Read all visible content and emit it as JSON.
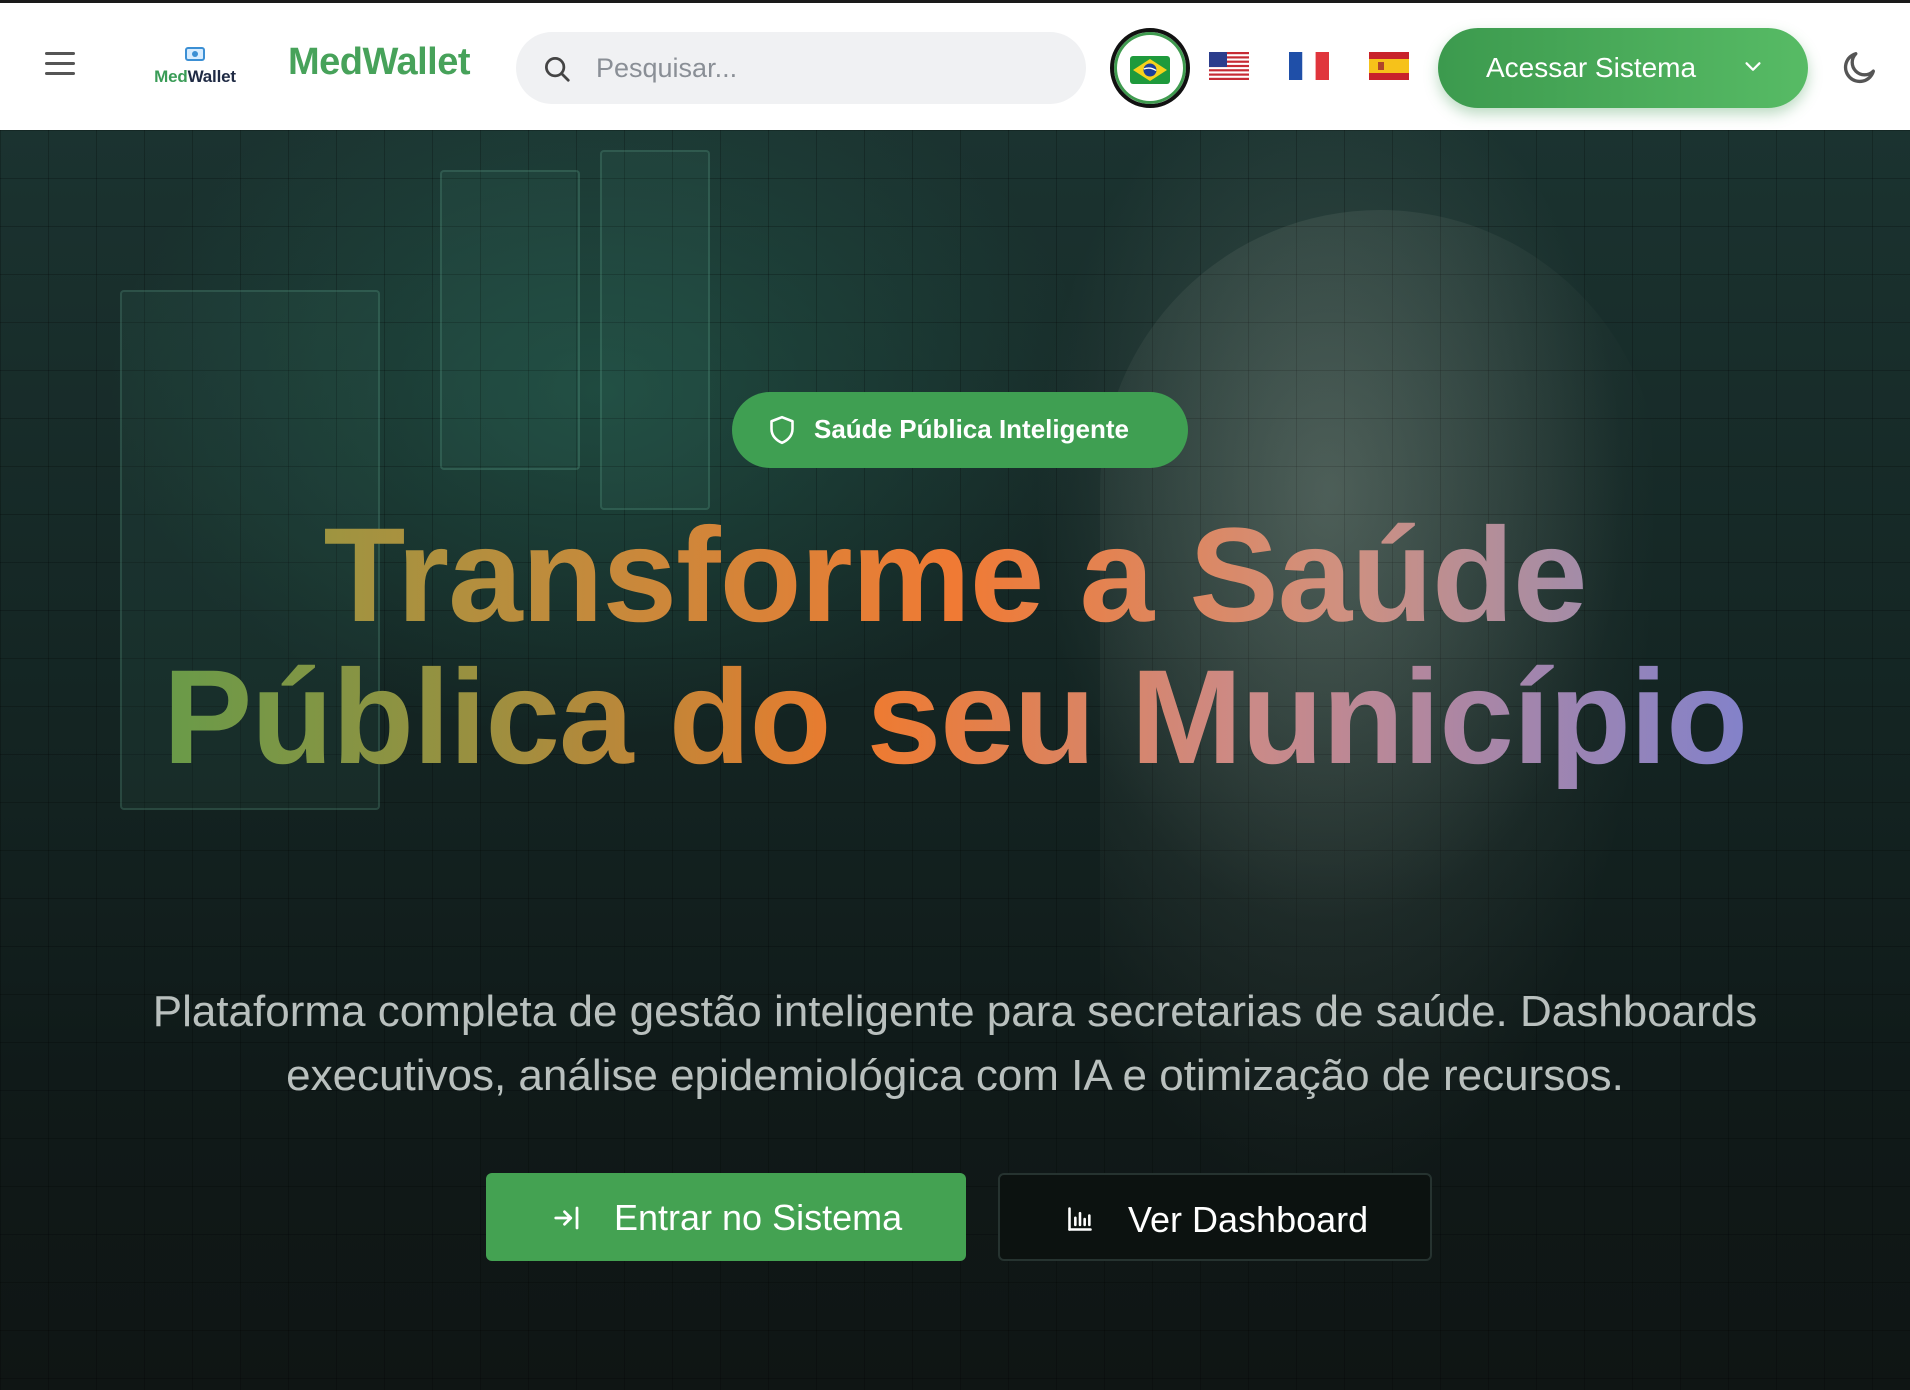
{
  "header": {
    "logo": {
      "text_med": "Med",
      "text_wallet": "Wallet"
    },
    "brand": "MedWallet",
    "search": {
      "placeholder": "Pesquisar..."
    },
    "languages": [
      {
        "code": "pt-BR",
        "flag": "🇧🇷",
        "active": true
      },
      {
        "code": "en-US",
        "flag": "🇺🇸",
        "active": false
      },
      {
        "code": "fr",
        "flag": "🇫🇷",
        "active": false
      },
      {
        "code": "es",
        "flag": "🇪🇸",
        "active": false
      }
    ],
    "cta_label": "Acessar Sistema",
    "theme_icon": "moon-icon"
  },
  "hero": {
    "badge": "Saúde Pública Inteligente",
    "headline_line1": "Transforme a Saúde",
    "headline_line2": "Pública do seu Município",
    "subtitle": "Plataforma completa de gestão inteligente para secretarias de saúde. Dashboards executivos, análise epidemiológica com IA e otimização de recursos.",
    "primary_button": "Entrar no Sistema",
    "secondary_button": "Ver Dashboard"
  },
  "colors": {
    "brand_green": "#47a25a",
    "cta_green": "#44a252",
    "dark_button": "#0c1210"
  }
}
